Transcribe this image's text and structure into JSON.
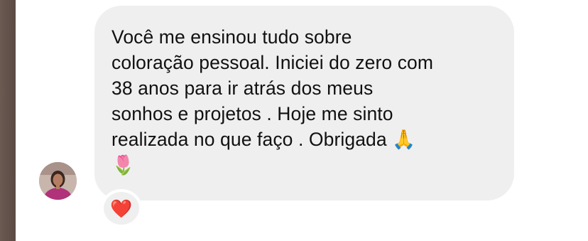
{
  "conversation": {
    "message": {
      "text": "Você me ensinou tudo sobre\ncoloração pessoal. Iniciei do zero com\n38 anos para ir atrás dos meus\nsonhos e projetos . Hoje me sinto\nrealizada no que faço . Obrigada 🙏\n🌷",
      "bubble_color": "#efefef"
    },
    "sender": {
      "avatar_icon": "profile-photo"
    },
    "reaction": {
      "emoji": "❤️",
      "icon": "heart-icon",
      "color": "#e0245e"
    }
  }
}
